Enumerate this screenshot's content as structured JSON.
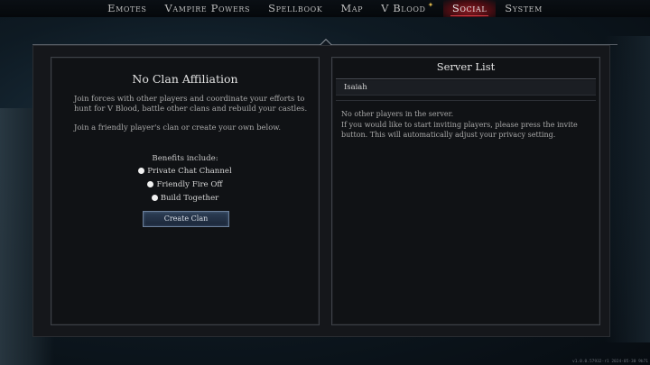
{
  "nav": {
    "items": [
      {
        "label": "Emotes"
      },
      {
        "label": "Vampire Powers"
      },
      {
        "label": "Spellbook"
      },
      {
        "label": "Map"
      },
      {
        "label": "V Blood"
      },
      {
        "label": "Social"
      },
      {
        "label": "System"
      }
    ],
    "active": "Social"
  },
  "clan": {
    "title": "No Clan Affiliation",
    "description": "Join forces with other players and coordinate your efforts to hunt for V Blood, battle other clans and rebuild your castles.",
    "invite_text": "Join a friendly player's clan or create your own below.",
    "benefits_heading": "Benefits include:",
    "benefits": [
      "Private Chat Channel",
      "Friendly Fire Off",
      "Build Together"
    ],
    "create_button": "Create Clan"
  },
  "server": {
    "title": "Server List",
    "players": [
      "Isaiah"
    ],
    "no_players_text": "No other players in the server.",
    "invite_text": "If you would like to start inviting players, please press the invite button. This will automatically adjust your privacy setting."
  },
  "version": "v1.0.0.57932-r1 2024-05-30 9b71"
}
